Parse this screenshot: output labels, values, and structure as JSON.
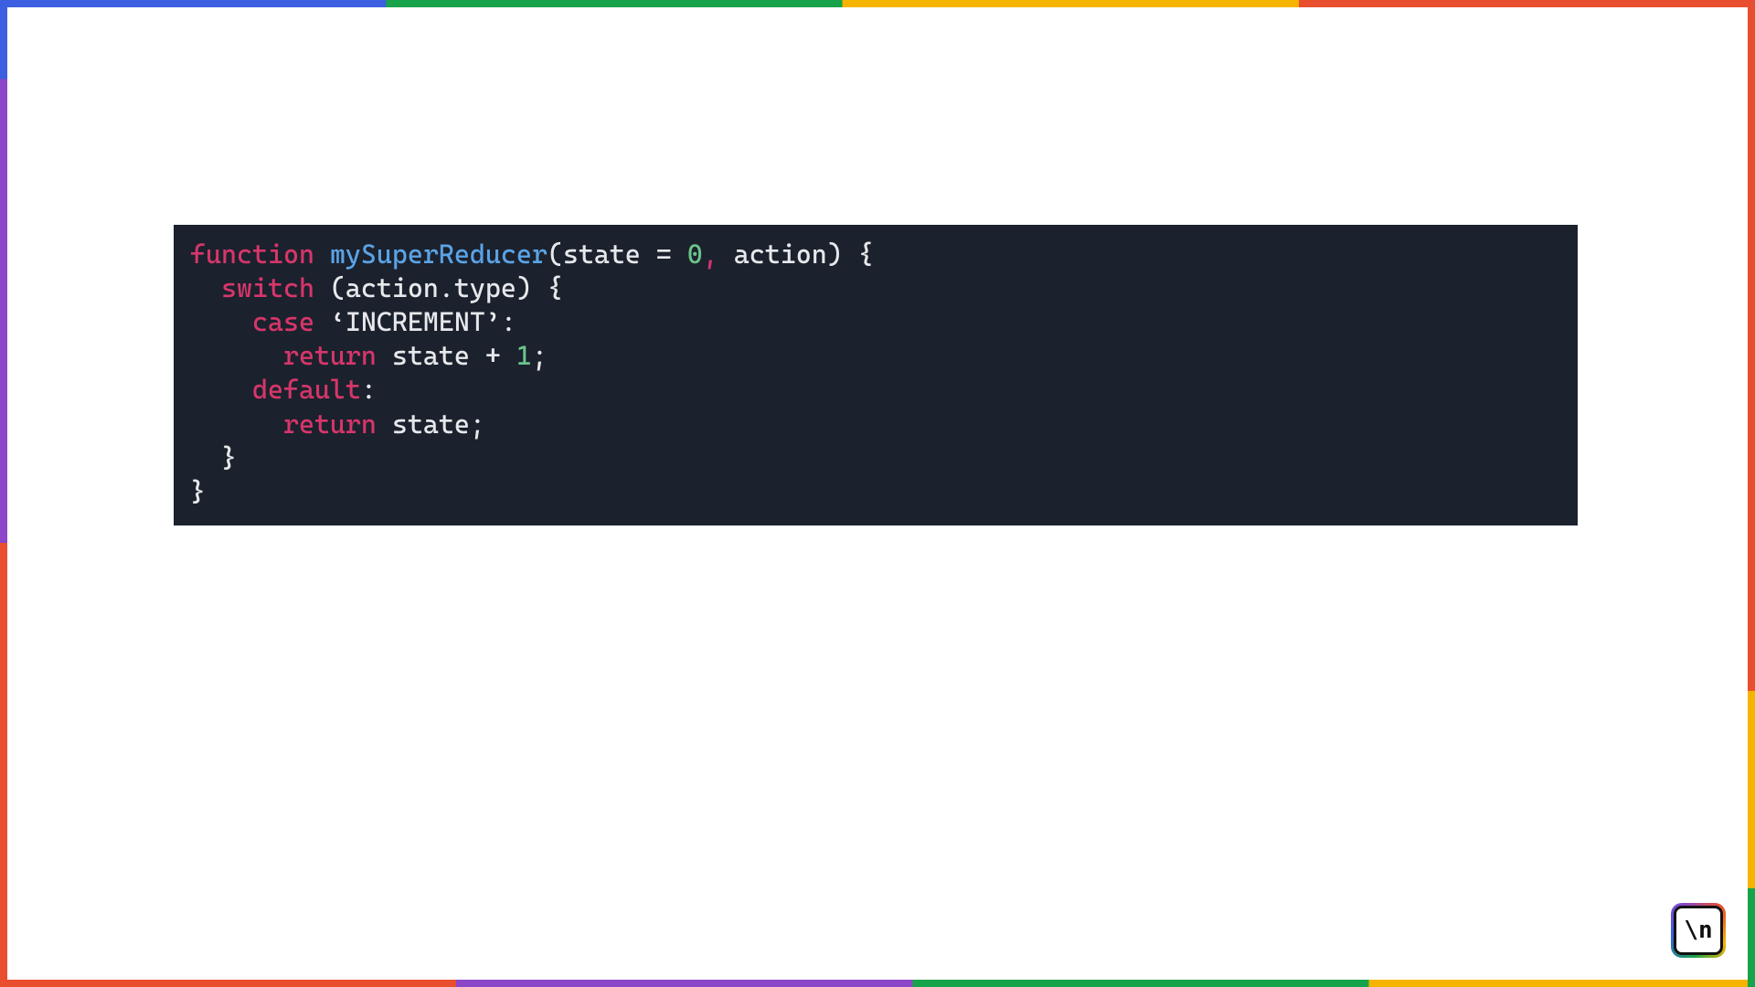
{
  "code": {
    "line1": {
      "kw_function": "function",
      "fn_name": "mySuperReducer",
      "lparen": "(",
      "param1": "state",
      "eq": " = ",
      "default_val": "0",
      "comma": ",",
      "param2": " action",
      "rparen": ")",
      "lbrace": " {"
    },
    "line2": {
      "indent": "  ",
      "kw_switch": "switch",
      "rest": " (action.type) {"
    },
    "line3": {
      "indent": "    ",
      "kw_case": "case",
      "space": " ",
      "str": "‘INCREMENT’",
      "colon": ":"
    },
    "line4": {
      "indent": "      ",
      "kw_return": "return",
      "mid": " state + ",
      "num": "1",
      "semi": ";"
    },
    "line5": {
      "indent": "    ",
      "kw_default": "default",
      "colon": ":"
    },
    "line6": {
      "indent": "      ",
      "kw_return": "return",
      "rest": " state;"
    },
    "line7": {
      "indent": "  ",
      "brace": "}"
    },
    "line8": {
      "brace": "}"
    }
  },
  "logo": {
    "text": "\\n"
  }
}
